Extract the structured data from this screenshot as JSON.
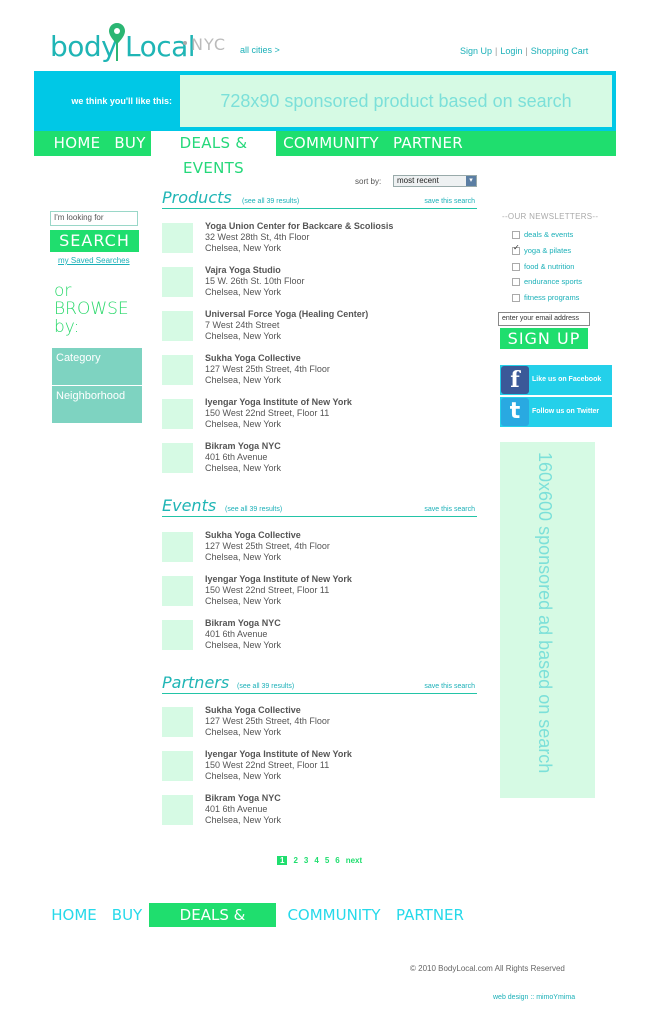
{
  "header": {
    "logo_body": "body",
    "logo_local": "Local",
    "logo_city": "NYC",
    "all_cities": "all cities >",
    "links": [
      "Sign Up",
      "Login",
      "Shopping Cart"
    ]
  },
  "banner": {
    "tagline": "we think you'll like this:",
    "ad_text": "728x90 sponsored product based on search"
  },
  "nav": {
    "items": [
      "HOME",
      "BUY",
      "DEALS & EVENTS",
      "COMMUNITY",
      "PARTNER"
    ],
    "active": "DEALS & EVENTS"
  },
  "left": {
    "lookfor_placeholder": "I'm looking for",
    "search_label": "SEARCH",
    "saved_searches": "my Saved Searches",
    "browse_l1": "or",
    "browse_l2": "BROWSE",
    "browse_l3": "by:",
    "category": "Category",
    "neighborhood": "Neighborhood"
  },
  "sort": {
    "label": "sort by:",
    "value": "most recent"
  },
  "sections": {
    "products": {
      "title": "Products",
      "see_all": "(see all 39 results)",
      "save": "save this search",
      "items": [
        {
          "name": "Yoga Union Center for Backcare & Scoliosis",
          "addr": "32 West 28th St, 4th Floor",
          "city": "Chelsea,   New York"
        },
        {
          "name": "Vajra Yoga Studio",
          "addr": "15 W. 26th St. 10th Floor",
          "city": "Chelsea,   New York"
        },
        {
          "name": "Universal Force Yoga (Healing Center)",
          "addr": "7 West 24th Street",
          "city": "Chelsea,   New York"
        },
        {
          "name": "Sukha Yoga Collective",
          "addr": "127 West 25th Street, 4th Floor",
          "city": "Chelsea,   New York"
        },
        {
          "name": "Iyengar Yoga Institute of New York",
          "addr": "150 West 22nd Street, Floor 11",
          "city": "Chelsea,   New York"
        },
        {
          "name": "Bikram Yoga NYC",
          "addr": "401 6th Avenue",
          "city": "Chelsea,   New York"
        }
      ]
    },
    "events": {
      "title": "Events",
      "see_all": "(see all 39 results)",
      "save": "save this search",
      "items": [
        {
          "name": "Sukha Yoga Collective",
          "addr": "127 West 25th Street, 4th Floor",
          "city": "Chelsea,   New York"
        },
        {
          "name": "Iyengar Yoga Institute of New York",
          "addr": "150 West 22nd Street, Floor 11",
          "city": "Chelsea,   New York"
        },
        {
          "name": "Bikram Yoga NYC",
          "addr": "401 6th Avenue",
          "city": "Chelsea,   New York"
        }
      ]
    },
    "partners": {
      "title": "Partners",
      "see_all": "(see all 39 results)",
      "save": "save this search",
      "items": [
        {
          "name": "Sukha Yoga Collective",
          "addr": "127 West 25th Street, 4th Floor",
          "city": "Chelsea,   New York"
        },
        {
          "name": "Iyengar Yoga Institute of New York",
          "addr": "150 West 22nd Street, Floor 11",
          "city": "Chelsea,   New York"
        },
        {
          "name": "Bikram Yoga NYC",
          "addr": "401 6th Avenue",
          "city": "Chelsea,   New York"
        }
      ]
    }
  },
  "pager": {
    "pages": [
      "1",
      "2",
      "3",
      "4",
      "5",
      "6"
    ],
    "current": "1",
    "next": "next"
  },
  "newsletters": {
    "title": "--OUR NEWSLETTERS--",
    "items": [
      {
        "label": "deals & events",
        "checked": false
      },
      {
        "label": "yoga & pilates",
        "checked": true
      },
      {
        "label": "food & nutrition",
        "checked": false
      },
      {
        "label": "endurance sports",
        "checked": false
      },
      {
        "label": "fitness programs",
        "checked": false
      }
    ],
    "email_placeholder": "enter your email address",
    "signup_label": "SIGN UP"
  },
  "social": {
    "facebook": "Like us on Facebook",
    "twitter": "Follow us on Twitter",
    "facebook_icon": "f",
    "twitter_icon": "t"
  },
  "skyscraper": {
    "text": "160x600 sponsored ad based on search"
  },
  "footer": {
    "copyright": "© 2010 BodyLocal.com All Rights Reserved",
    "credit": "web design :: mimoYmima"
  },
  "colors": {
    "green": "#1fde6e",
    "cyan": "#00c8e6",
    "teal": "#1fb5b5",
    "mint": "#d6fae4",
    "sidebar_box": "#7ed3c1"
  }
}
